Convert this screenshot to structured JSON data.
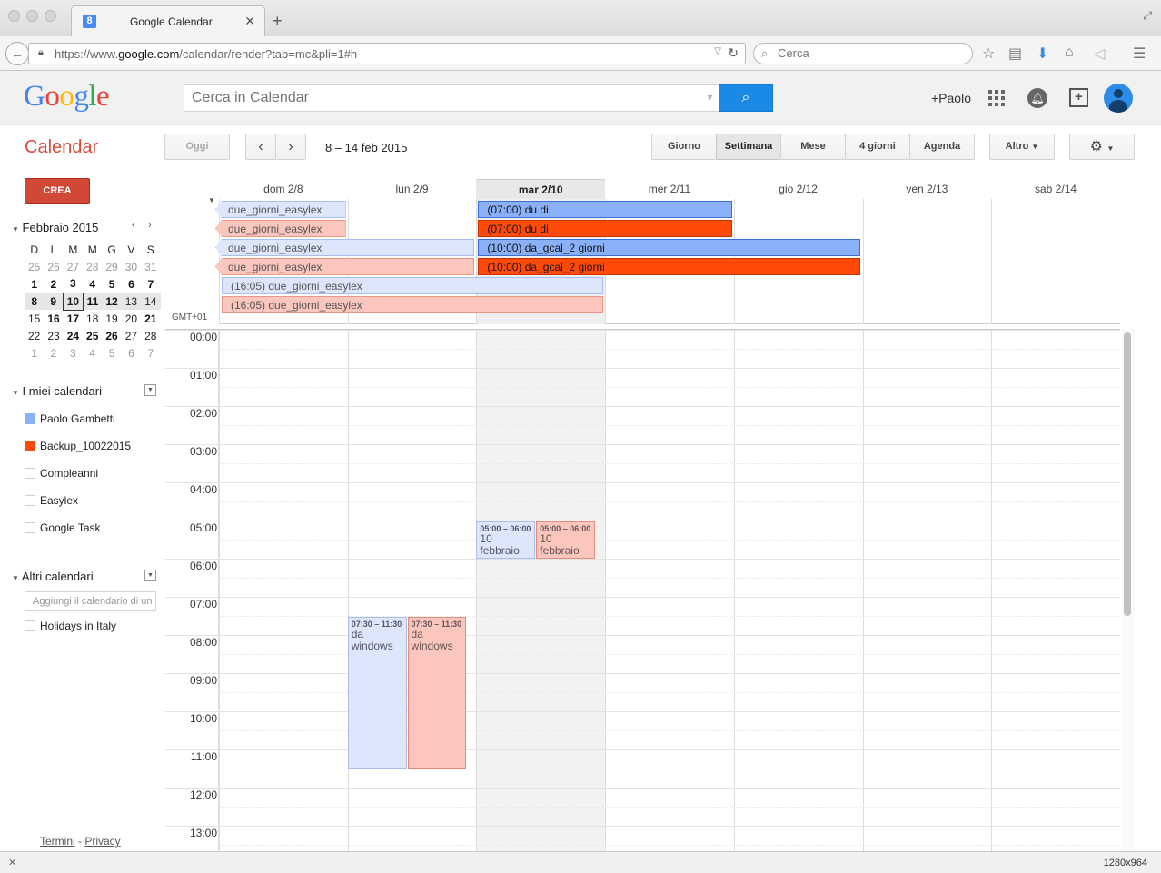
{
  "browser": {
    "tab_title": "Google Calendar",
    "favicon": "8",
    "url_prefix": "https://www.",
    "url_domain": "google.com",
    "url_path": "/calendar/render?tab=mc&pli=1#h",
    "search_placeholder": "Cerca",
    "status_dims": "1280x964"
  },
  "gbar": {
    "search_placeholder": "Cerca in Calendar",
    "user": "+Paolo",
    "colors": {
      "blue": "#4285f4",
      "red": "#ea4335",
      "yellow": "#fbbc05",
      "green": "#34a853"
    }
  },
  "toolbar": {
    "app_name": "Calendar",
    "today": "Oggi",
    "date_range": "8 – 14 feb 2015",
    "views": {
      "day": "Giorno",
      "week": "Settimana",
      "month": "Mese",
      "four_days": "4 giorni",
      "agenda": "Agenda"
    },
    "more": "Altro",
    "active_view": "Settimana"
  },
  "sidebar": {
    "create": "CREA",
    "mini_title": "Febbraio 2015",
    "weekday_headers": [
      "D",
      "L",
      "M",
      "M",
      "G",
      "V",
      "S"
    ],
    "weeks": [
      [
        "25",
        "26",
        "27",
        "28",
        "29",
        "30",
        "31"
      ],
      [
        "1",
        "2",
        "3",
        "4",
        "5",
        "6",
        "7"
      ],
      [
        "8",
        "9",
        "10",
        "11",
        "12",
        "13",
        "14"
      ],
      [
        "15",
        "16",
        "17",
        "18",
        "19",
        "20",
        "21"
      ],
      [
        "22",
        "23",
        "24",
        "25",
        "26",
        "27",
        "28"
      ],
      [
        "1",
        "2",
        "3",
        "4",
        "5",
        "6",
        "7"
      ]
    ],
    "my_calendars_title": "I miei calendari",
    "my_calendars": [
      {
        "name": "Paolo Gambetti",
        "color": "#8ab0f8"
      },
      {
        "name": "Backup_10022015",
        "color": "#ff4a0a"
      },
      {
        "name": "Compleanni",
        "color": ""
      },
      {
        "name": "Easylex",
        "color": ""
      },
      {
        "name": "Google Task",
        "color": ""
      }
    ],
    "other_calendars_title": "Altri calendari",
    "add_calendar_placeholder": "Aggiungi il calendario di un",
    "other_calendars": [
      {
        "name": "Holidays in Italy",
        "color": ""
      }
    ],
    "footer_terms": "Termini",
    "footer_sep": " - ",
    "footer_privacy": "Privacy"
  },
  "week": {
    "days": [
      "dom 2/8",
      "lun 2/9",
      "mar 2/10",
      "mer 2/11",
      "gio 2/12",
      "ven 2/13",
      "sab 2/14"
    ],
    "today_index": 2,
    "timezone": "GMT+01",
    "hours": [
      "00:00",
      "01:00",
      "02:00",
      "03:00",
      "04:00",
      "05:00",
      "06:00",
      "07:00",
      "08:00",
      "09:00",
      "10:00",
      "11:00",
      "12:00",
      "13:00"
    ],
    "all_day_events": [
      {
        "label": "due_giorni_easylex",
        "style": "lb"
      },
      {
        "label": "due_giorni_easylex",
        "style": "lr"
      },
      {
        "label": "due_giorni_easylex",
        "style": "lb"
      },
      {
        "label": "due_giorni_easylex",
        "style": "lr"
      },
      {
        "label": "(16:05) due_giorni_easylex",
        "style": "lb"
      },
      {
        "label": "(16:05) due_giorni_easylex",
        "style": "lr"
      },
      {
        "label": "(07:00) du di",
        "style": "sb"
      },
      {
        "label": "(07:00) du di",
        "style": "sr"
      },
      {
        "label": "(10:00) da_gcal_2 giorni",
        "style": "sb"
      },
      {
        "label": "(10:00) da_gcal_2 giorni",
        "style": "sr"
      }
    ],
    "timed_events": [
      {
        "time": "05:00 – 06:00",
        "name": "10 febbraio",
        "style": "b"
      },
      {
        "time": "05:00 – 06:00",
        "name": "10 febbraio",
        "style": "r"
      },
      {
        "time": "07:30 – 11:30",
        "name": "da windows",
        "style": "b"
      },
      {
        "time": "07:30 – 11:30",
        "name": "da windows",
        "style": "r"
      }
    ]
  }
}
